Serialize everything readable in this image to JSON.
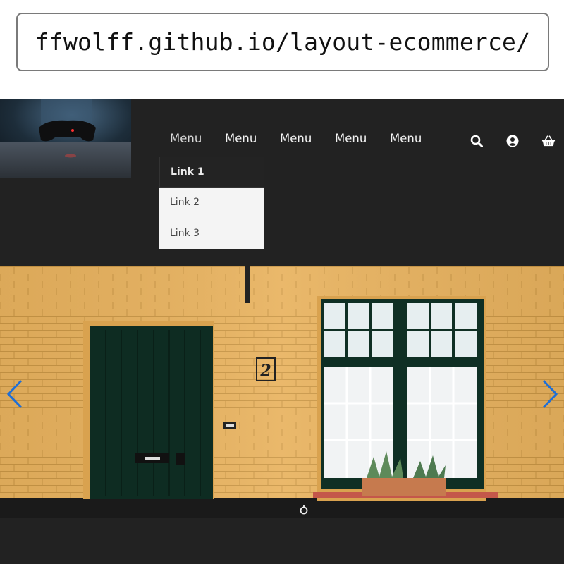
{
  "browser": {
    "url": "ffwolff.github.io/layout-ecommerce/"
  },
  "header": {
    "logo_icon": "gamepad-photo",
    "menu": [
      {
        "label": "Menu"
      },
      {
        "label": "Menu"
      },
      {
        "label": "Menu"
      },
      {
        "label": "Menu"
      },
      {
        "label": "Menu"
      }
    ],
    "dropdown": [
      {
        "label": "Link 1"
      },
      {
        "label": "Link 2"
      },
      {
        "label": "Link 3"
      }
    ],
    "icons": [
      "search-icon",
      "user-icon",
      "basket-icon"
    ]
  },
  "hero": {
    "image": "yellow-brick-facade-green-door-window",
    "house_number": "2",
    "prev_icon": "chevron-left-icon",
    "next_icon": "chevron-right-icon",
    "indicator_icon": "slide-indicator-icon"
  },
  "colors": {
    "header_bg": "#222222",
    "arrow": "#1f6fd6",
    "dropdown_bg": "#f4f4f4"
  }
}
